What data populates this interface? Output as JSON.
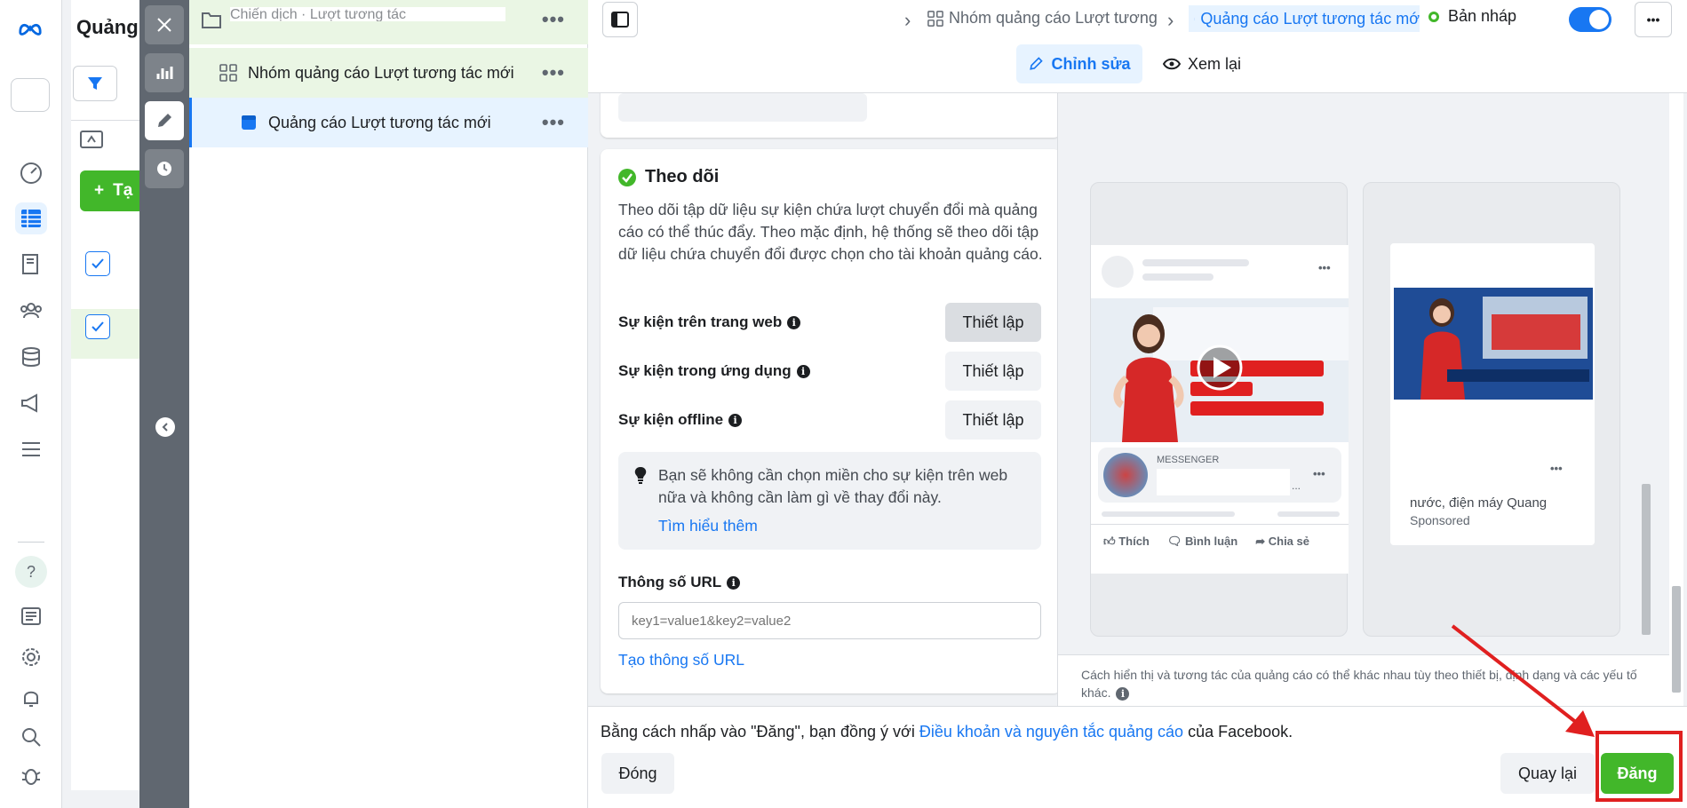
{
  "campaign": {
    "title": "Quảng",
    "create_label": "Tạ"
  },
  "tree": {
    "campaign_name": "Chiến dịch · Lượt tương tác",
    "adset_name": "Nhóm quảng cáo Lượt tương tác mới",
    "ad_name": "Quảng cáo Lượt tương tác mới",
    "more": "•••"
  },
  "topbar": {
    "breadcrumb_adset": "Nhóm quảng cáo Lượt tương",
    "breadcrumb_ad": "Quảng cáo Lượt tương tác mớ",
    "status": "Bản nháp",
    "edit_tab": "Chỉnh sửa",
    "review_tab": "Xem lại",
    "more": "•••",
    "chevron": "›"
  },
  "tracking": {
    "title": "Theo dõi",
    "description": "Theo dõi tập dữ liệu sự kiện chứa lượt chuyển đổi mà quảng cáo có thể thúc đẩy. Theo mặc định, hệ thống sẽ theo dõi tập dữ liệu chứa chuyển đổi được chọn cho tài khoản quảng cáo.",
    "web_events": "Sự kiện trên trang web",
    "app_events": "Sự kiện trong ứng dụng",
    "offline_events": "Sự kiện offline",
    "setup_label": "Thiết lập",
    "notice": "Bạn sẽ không cần chọn miền cho sự kiện trên web nữa và không cần làm gì về thay đổi này.",
    "learn_more": "Tìm hiểu thêm",
    "url_params_label": "Thông số URL",
    "url_params_placeholder": "key1=value1&key2=value2",
    "create_url_params": "Tạo thông số URL"
  },
  "preview": {
    "messenger_label": "MESSENGER",
    "like": "Thích",
    "comment": "Bình luận",
    "share": "Chia sẻ",
    "story_text": "nước, điện máy Quang",
    "sponsored": "Sponsored",
    "note": "Cách hiển thị và tương tác của quảng cáo có thể khác nhau tùy theo thiết bị, định dạng và các yếu tố khác.",
    "more": "•••",
    "ellipsis": "..."
  },
  "footer": {
    "terms_prefix": "Bằng cách nhấp vào \"Đăng\", bạn đồng ý với ",
    "terms_link": "Điều khoản và nguyên tắc quảng cáo",
    "terms_suffix": " của Facebook.",
    "close_label": "Đóng",
    "back_label": "Quay lại",
    "publish_label": "Đăng"
  },
  "colors": {
    "accent": "#1877f2",
    "publish_green": "#42b72a",
    "annotation_red": "#e02020",
    "success_green": "#42b72a"
  }
}
